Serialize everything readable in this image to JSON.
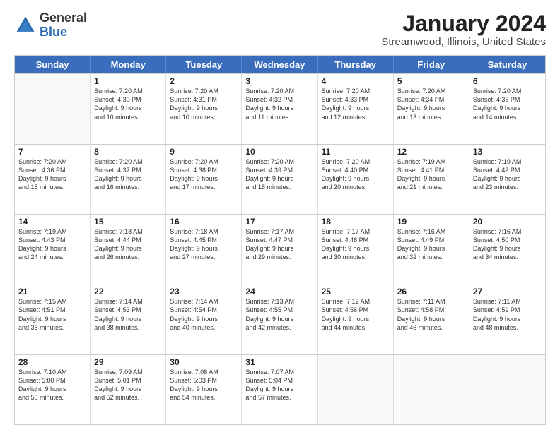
{
  "header": {
    "logo_general": "General",
    "logo_blue": "Blue",
    "title": "January 2024",
    "location": "Streamwood, Illinois, United States"
  },
  "calendar": {
    "days": [
      "Sunday",
      "Monday",
      "Tuesday",
      "Wednesday",
      "Thursday",
      "Friday",
      "Saturday"
    ],
    "rows": [
      [
        {
          "day": "",
          "info": ""
        },
        {
          "day": "1",
          "info": "Sunrise: 7:20 AM\nSunset: 4:30 PM\nDaylight: 9 hours\nand 10 minutes."
        },
        {
          "day": "2",
          "info": "Sunrise: 7:20 AM\nSunset: 4:31 PM\nDaylight: 9 hours\nand 10 minutes."
        },
        {
          "day": "3",
          "info": "Sunrise: 7:20 AM\nSunset: 4:32 PM\nDaylight: 9 hours\nand 11 minutes."
        },
        {
          "day": "4",
          "info": "Sunrise: 7:20 AM\nSunset: 4:33 PM\nDaylight: 9 hours\nand 12 minutes."
        },
        {
          "day": "5",
          "info": "Sunrise: 7:20 AM\nSunset: 4:34 PM\nDaylight: 9 hours\nand 13 minutes."
        },
        {
          "day": "6",
          "info": "Sunrise: 7:20 AM\nSunset: 4:35 PM\nDaylight: 9 hours\nand 14 minutes."
        }
      ],
      [
        {
          "day": "7",
          "info": "Sunrise: 7:20 AM\nSunset: 4:36 PM\nDaylight: 9 hours\nand 15 minutes."
        },
        {
          "day": "8",
          "info": "Sunrise: 7:20 AM\nSunset: 4:37 PM\nDaylight: 9 hours\nand 16 minutes."
        },
        {
          "day": "9",
          "info": "Sunrise: 7:20 AM\nSunset: 4:38 PM\nDaylight: 9 hours\nand 17 minutes."
        },
        {
          "day": "10",
          "info": "Sunrise: 7:20 AM\nSunset: 4:39 PM\nDaylight: 9 hours\nand 18 minutes."
        },
        {
          "day": "11",
          "info": "Sunrise: 7:20 AM\nSunset: 4:40 PM\nDaylight: 9 hours\nand 20 minutes."
        },
        {
          "day": "12",
          "info": "Sunrise: 7:19 AM\nSunset: 4:41 PM\nDaylight: 9 hours\nand 21 minutes."
        },
        {
          "day": "13",
          "info": "Sunrise: 7:19 AM\nSunset: 4:42 PM\nDaylight: 9 hours\nand 23 minutes."
        }
      ],
      [
        {
          "day": "14",
          "info": "Sunrise: 7:19 AM\nSunset: 4:43 PM\nDaylight: 9 hours\nand 24 minutes."
        },
        {
          "day": "15",
          "info": "Sunrise: 7:18 AM\nSunset: 4:44 PM\nDaylight: 9 hours\nand 26 minutes."
        },
        {
          "day": "16",
          "info": "Sunrise: 7:18 AM\nSunset: 4:45 PM\nDaylight: 9 hours\nand 27 minutes."
        },
        {
          "day": "17",
          "info": "Sunrise: 7:17 AM\nSunset: 4:47 PM\nDaylight: 9 hours\nand 29 minutes."
        },
        {
          "day": "18",
          "info": "Sunrise: 7:17 AM\nSunset: 4:48 PM\nDaylight: 9 hours\nand 30 minutes."
        },
        {
          "day": "19",
          "info": "Sunrise: 7:16 AM\nSunset: 4:49 PM\nDaylight: 9 hours\nand 32 minutes."
        },
        {
          "day": "20",
          "info": "Sunrise: 7:16 AM\nSunset: 4:50 PM\nDaylight: 9 hours\nand 34 minutes."
        }
      ],
      [
        {
          "day": "21",
          "info": "Sunrise: 7:15 AM\nSunset: 4:51 PM\nDaylight: 9 hours\nand 36 minutes."
        },
        {
          "day": "22",
          "info": "Sunrise: 7:14 AM\nSunset: 4:53 PM\nDaylight: 9 hours\nand 38 minutes."
        },
        {
          "day": "23",
          "info": "Sunrise: 7:14 AM\nSunset: 4:54 PM\nDaylight: 9 hours\nand 40 minutes."
        },
        {
          "day": "24",
          "info": "Sunrise: 7:13 AM\nSunset: 4:55 PM\nDaylight: 9 hours\nand 42 minutes."
        },
        {
          "day": "25",
          "info": "Sunrise: 7:12 AM\nSunset: 4:56 PM\nDaylight: 9 hours\nand 44 minutes."
        },
        {
          "day": "26",
          "info": "Sunrise: 7:11 AM\nSunset: 4:58 PM\nDaylight: 9 hours\nand 46 minutes."
        },
        {
          "day": "27",
          "info": "Sunrise: 7:11 AM\nSunset: 4:59 PM\nDaylight: 9 hours\nand 48 minutes."
        }
      ],
      [
        {
          "day": "28",
          "info": "Sunrise: 7:10 AM\nSunset: 5:00 PM\nDaylight: 9 hours\nand 50 minutes."
        },
        {
          "day": "29",
          "info": "Sunrise: 7:09 AM\nSunset: 5:01 PM\nDaylight: 9 hours\nand 52 minutes."
        },
        {
          "day": "30",
          "info": "Sunrise: 7:08 AM\nSunset: 5:03 PM\nDaylight: 9 hours\nand 54 minutes."
        },
        {
          "day": "31",
          "info": "Sunrise: 7:07 AM\nSunset: 5:04 PM\nDaylight: 9 hours\nand 57 minutes."
        },
        {
          "day": "",
          "info": ""
        },
        {
          "day": "",
          "info": ""
        },
        {
          "day": "",
          "info": ""
        }
      ]
    ]
  }
}
